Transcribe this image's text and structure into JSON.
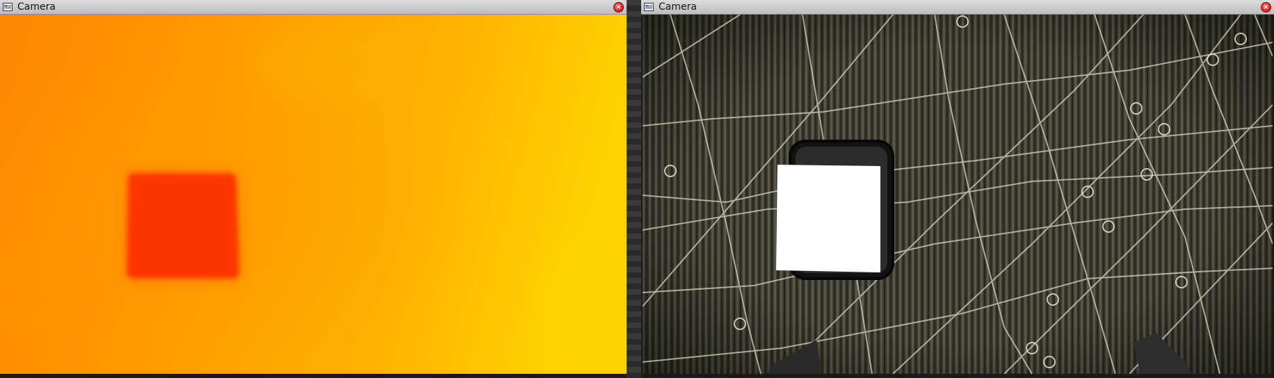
{
  "windows": [
    {
      "title": "Camera",
      "feed": "thermal-heatmap-feed"
    },
    {
      "title": "Camera",
      "feed": "rgb-camera-feed"
    }
  ],
  "colors": {
    "thermal_hot_spot": "#ff3300",
    "thermal_background_left": "#ff8a00",
    "thermal_background_right": "#ffd000",
    "close_button": "#d10000"
  },
  "icons": {
    "window_icon": "window-app-icon",
    "close": "close-icon"
  }
}
